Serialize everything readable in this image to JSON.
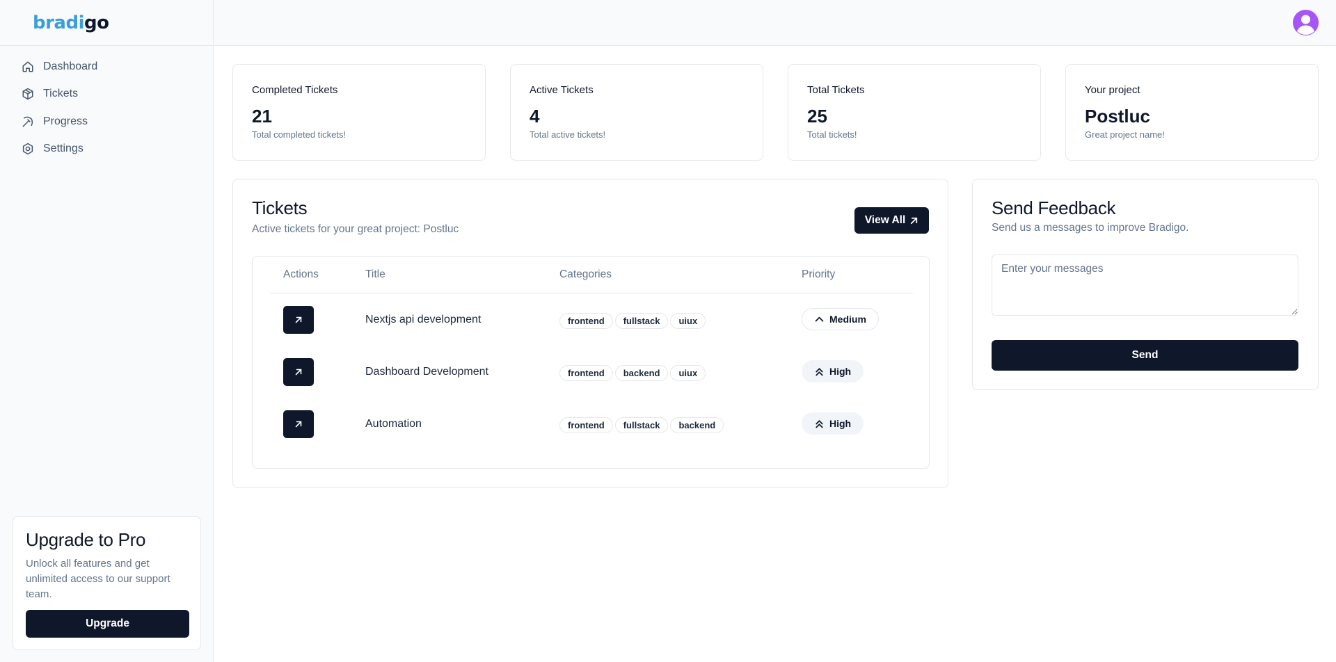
{
  "brand": {
    "part1": "bradi",
    "part2": "go"
  },
  "sidebar": {
    "items": [
      {
        "label": "Dashboard",
        "icon": "home-icon"
      },
      {
        "label": "Tickets",
        "icon": "package-icon"
      },
      {
        "label": "Progress",
        "icon": "pickaxe-icon"
      },
      {
        "label": "Settings",
        "icon": "gear-icon"
      }
    ],
    "upgrade": {
      "title": "Upgrade to Pro",
      "text": "Unlock all features and get unlimited access to our support team.",
      "button": "Upgrade"
    }
  },
  "header": {
    "avatar": "user-avatar-icon"
  },
  "stats": [
    {
      "label": "Completed Tickets",
      "value": "21",
      "sub": "Total completed tickets!"
    },
    {
      "label": "Active Tickets",
      "value": "4",
      "sub": "Total active tickets!"
    },
    {
      "label": "Total Tickets",
      "value": "25",
      "sub": "Total tickets!"
    },
    {
      "label": "Your project",
      "value": "Postluc",
      "sub": "Great project name!"
    }
  ],
  "tickets": {
    "title": "Tickets",
    "subtitle": "Active tickets for your great project: Postluc",
    "view_all": "View All",
    "columns": [
      "Actions",
      "Title",
      "Categories",
      "Priority"
    ],
    "rows": [
      {
        "title": "Nextjs api development",
        "tags": [
          "frontend",
          "fullstack",
          "uiux"
        ],
        "priority": "Medium"
      },
      {
        "title": "Dashboard Development",
        "tags": [
          "frontend",
          "backend",
          "uiux"
        ],
        "priority": "High"
      },
      {
        "title": "Automation",
        "tags": [
          "frontend",
          "fullstack",
          "backend"
        ],
        "priority": "High"
      }
    ]
  },
  "feedback": {
    "title": "Send Feedback",
    "subtitle": "Send us a messages to improve Bradigo.",
    "placeholder": "Enter your messages",
    "button": "Send"
  },
  "colors": {
    "primary": "#0f172a",
    "brand_blue": "#3b9ed8",
    "muted": "#64748b",
    "border": "#e5e7eb",
    "avatar": "#a855f7"
  }
}
